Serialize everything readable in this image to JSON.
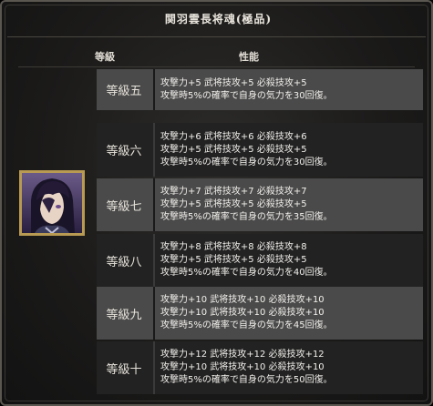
{
  "title": "関羽雲長将魂(極品)",
  "headers": {
    "level": "等級",
    "performance": "性能"
  },
  "rows": [
    {
      "level": "等級五",
      "lines": [
        "攻撃力+5 武将技攻+5 必殺技攻+5",
        "攻撃時5%の確率で自身の気力を30回復。"
      ]
    },
    {
      "level": "等級六",
      "lines": [
        "攻撃力+6 武将技攻+6 必殺技攻+6",
        "攻撃力+5 武将技攻+5 必殺技攻+5",
        "攻撃時5%の確率で自身の気力を30回復。"
      ]
    },
    {
      "level": "等級七",
      "lines": [
        "攻撃力+7 武将技攻+7 必殺技攻+7",
        "攻撃力+5 武将技攻+5 必殺技攻+5",
        "攻撃時5%の確率で自身の気力を35回復。"
      ]
    },
    {
      "level": "等級八",
      "lines": [
        "攻撃力+8 武将技攻+8 必殺技攻+8",
        "攻撃力+5 武将技攻+5 必殺技攻+5",
        "攻撃時5%の確率で自身の気力を40回復。"
      ]
    },
    {
      "level": "等級九",
      "lines": [
        "攻撃力+10 武将技攻+10 必殺技攻+10",
        "攻撃力+10 武将技攻+10 必殺技攻+10",
        "攻撃時5%の確率で自身の気力を45回復。"
      ]
    },
    {
      "level": "等級十",
      "lines": [
        "攻撃力+12 武将技攻+12 必殺技攻+12",
        "攻撃力+10 武将技攻+10 必殺技攻+10",
        "攻撃時5%の確率で自身の気力を50回復。"
      ]
    }
  ]
}
